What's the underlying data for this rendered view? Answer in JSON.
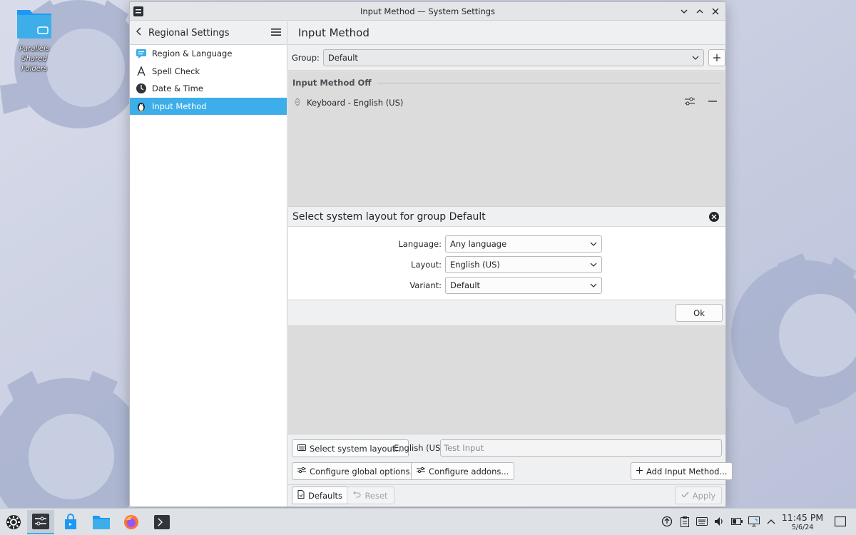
{
  "desktop": {
    "icon_label_line1": "Parallels Shared",
    "icon_label_line2": "Folders"
  },
  "window": {
    "title": "Input Method — System Settings"
  },
  "sidebar": {
    "header_title": "Regional Settings",
    "items": [
      {
        "label": "Region & Language",
        "icon": "region-icon"
      },
      {
        "label": "Spell Check",
        "icon": "spellcheck-icon"
      },
      {
        "label": "Date & Time",
        "icon": "clock-icon"
      },
      {
        "label": "Input Method",
        "icon": "penguin-icon",
        "active": true
      }
    ]
  },
  "content": {
    "title": "Input Method",
    "group_label": "Group:",
    "group_value": "Default",
    "section_title": "Input Method Off",
    "im_item": "Keyboard - English (US)"
  },
  "dialog": {
    "title": "Select system layout for group Default",
    "language_label": "Language:",
    "language_value": "Any language",
    "layout_label": "Layout:",
    "layout_value": "English (US)",
    "variant_label": "Variant:",
    "variant_value": "Default",
    "ok_label": "Ok"
  },
  "bottom": {
    "select_layout_label": "Select system layout...",
    "current_layout": "English (US)",
    "test_input_placeholder": "Test Input",
    "configure_global_label": "Configure global options...",
    "configure_addons_label": "Configure addons...",
    "add_input_method_label": "Add Input Method..."
  },
  "footer": {
    "defaults_label": "Defaults",
    "reset_label": "Reset",
    "apply_label": "Apply"
  },
  "taskbar": {
    "time": "11:45 PM",
    "date": "5/6/24"
  },
  "colors": {
    "accent": "#3daee9",
    "wallpaper": "#c9cfe0",
    "window_bg": "#eff0f1"
  }
}
